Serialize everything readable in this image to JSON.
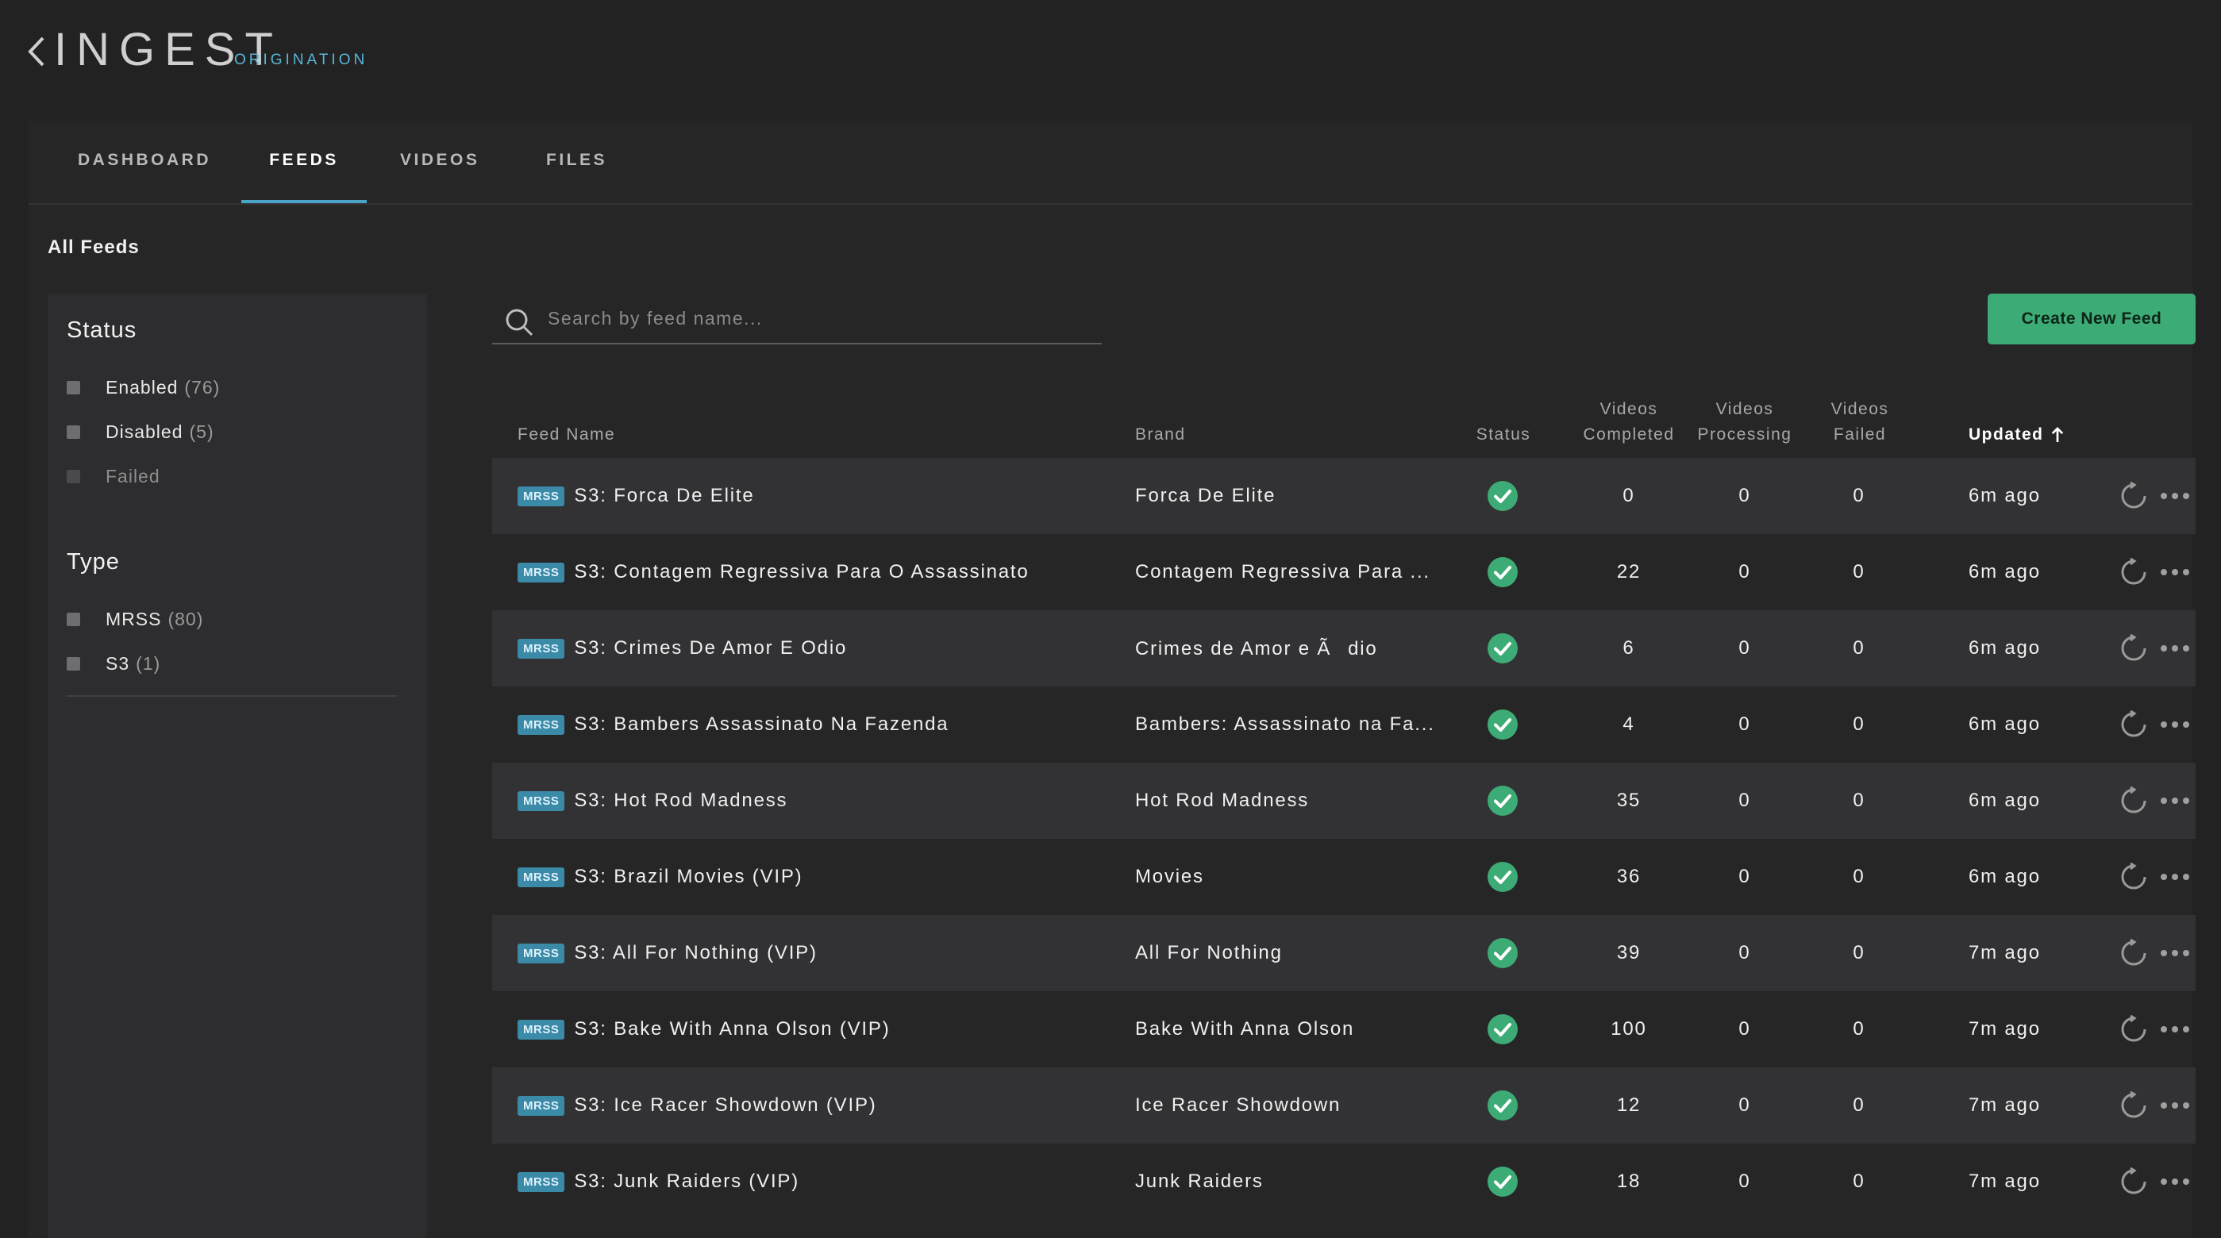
{
  "app": {
    "title": "INGEST",
    "subtitle": "ORIGINATION"
  },
  "tabs": [
    {
      "label": "DASHBOARD",
      "active": false
    },
    {
      "label": "FEEDS",
      "active": true
    },
    {
      "label": "VIDEOS",
      "active": false
    },
    {
      "label": "FILES",
      "active": false
    }
  ],
  "page_title": "All Feeds",
  "filters": {
    "status": {
      "title": "Status",
      "options": [
        {
          "label": "Enabled",
          "count": "(76)"
        },
        {
          "label": "Disabled",
          "count": "(5)"
        },
        {
          "label": "Failed",
          "count": ""
        }
      ]
    },
    "type": {
      "title": "Type",
      "options": [
        {
          "label": "MRSS",
          "count": "(80)"
        },
        {
          "label": "S3",
          "count": "(1)"
        }
      ]
    }
  },
  "search": {
    "placeholder": "Search by feed name..."
  },
  "create_button": "Create New Feed",
  "table": {
    "headers": {
      "feed_name": "Feed Name",
      "brand": "Brand",
      "status": "Status",
      "videos_completed": [
        "Videos",
        "Completed"
      ],
      "videos_processing": [
        "Videos",
        "Processing"
      ],
      "videos_failed": [
        "Videos",
        "Failed"
      ],
      "updated": "Updated"
    },
    "sort": {
      "column": "Updated",
      "direction": "ascending",
      "icon": "arrow-up-icon"
    },
    "rows": [
      {
        "badge": "MRSS",
        "name": "S3: Forca De Elite",
        "brand": "Forca De Elite",
        "completed": "0",
        "processing": "0",
        "failed": "0",
        "updated": "6m ago"
      },
      {
        "badge": "MRSS",
        "name": "S3: Contagem Regressiva Para O Assassinato",
        "brand": "Contagem Regressiva Para ...",
        "completed": "22",
        "processing": "0",
        "failed": "0",
        "updated": "6m ago"
      },
      {
        "badge": "MRSS",
        "name": "S3: Crimes De Amor E Odio",
        "brand": "Crimes de Amor e Ãdio",
        "completed": "6",
        "processing": "0",
        "failed": "0",
        "updated": "6m ago"
      },
      {
        "badge": "MRSS",
        "name": "S3: Bambers Assassinato Na Fazenda",
        "brand": "Bambers: Assassinato na Fa...",
        "completed": "4",
        "processing": "0",
        "failed": "0",
        "updated": "6m ago"
      },
      {
        "badge": "MRSS",
        "name": "S3: Hot Rod Madness",
        "brand": "Hot Rod Madness",
        "completed": "35",
        "processing": "0",
        "failed": "0",
        "updated": "6m ago"
      },
      {
        "badge": "MRSS",
        "name": "S3: Brazil Movies (VIP)",
        "brand": "Movies",
        "completed": "36",
        "processing": "0",
        "failed": "0",
        "updated": "6m ago"
      },
      {
        "badge": "MRSS",
        "name": "S3: All For Nothing (VIP)",
        "brand": "All For Nothing",
        "completed": "39",
        "processing": "0",
        "failed": "0",
        "updated": "7m ago"
      },
      {
        "badge": "MRSS",
        "name": "S3: Bake With Anna Olson (VIP)",
        "brand": "Bake With Anna Olson",
        "completed": "100",
        "processing": "0",
        "failed": "0",
        "updated": "7m ago"
      },
      {
        "badge": "MRSS",
        "name": "S3: Ice Racer Showdown (VIP)",
        "brand": "Ice Racer Showdown",
        "completed": "12",
        "processing": "0",
        "failed": "0",
        "updated": "7m ago"
      },
      {
        "badge": "MRSS",
        "name": "S3: Junk Raiders (VIP)",
        "brand": "Junk Raiders",
        "completed": "18",
        "processing": "0",
        "failed": "0",
        "updated": "7m ago"
      }
    ]
  },
  "colors": {
    "accent": "#4aa3c8",
    "primary_button": "#3dab75",
    "status_ok": "#3dab75",
    "badge": "#3b8aa8",
    "background": "#222223"
  },
  "icons": {
    "back": "chevron-left-icon",
    "search": "search-icon",
    "status": "check-circle-icon",
    "refresh": "refresh-icon",
    "more": "more-horizontal-icon"
  }
}
